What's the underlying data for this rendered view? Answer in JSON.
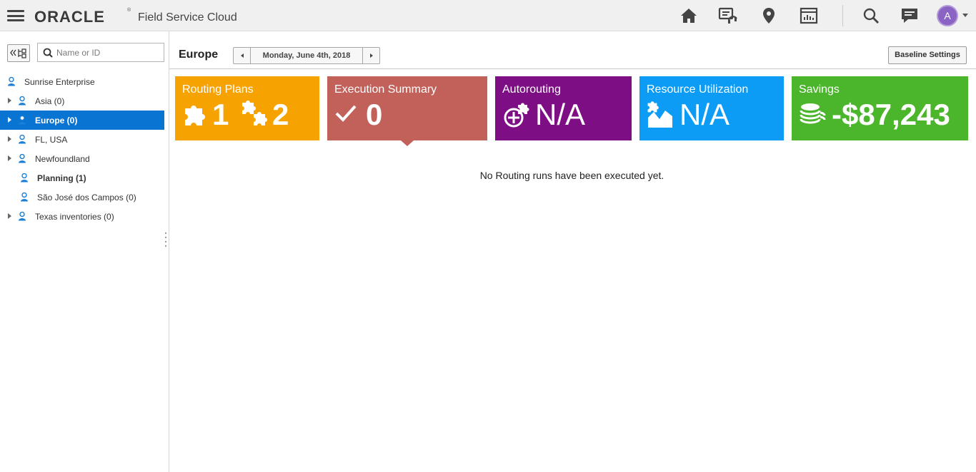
{
  "header": {
    "brand": "ORACLE",
    "brand_mark": "®",
    "product": "Field Service Cloud",
    "icons": [
      "home-icon",
      "dispatch-console-icon",
      "map-pin-icon",
      "reports-icon",
      "search-icon",
      "messages-icon"
    ],
    "avatar_initial": "A"
  },
  "sidebar": {
    "collapse_label": "«",
    "search_placeholder": "Name or ID",
    "search_value": "",
    "tree": [
      {
        "label": "Sunrise Enterprise",
        "expandable": false
      },
      {
        "label": "Asia (0)",
        "expandable": true
      },
      {
        "label": "Europe (0)",
        "expandable": true,
        "selected": true
      },
      {
        "label": "FL, USA",
        "expandable": true
      },
      {
        "label": "Newfoundland",
        "expandable": true
      },
      {
        "label": "Planning (1)",
        "expandable": false
      },
      {
        "label": "São José dos Campos (0)",
        "expandable": false
      },
      {
        "label": "Texas inventories (0)",
        "expandable": true
      }
    ]
  },
  "main": {
    "title": "Europe",
    "date": "Monday, June 4th, 2018",
    "baseline_button": "Baseline Settings",
    "tiles": [
      {
        "title": "Routing Plans",
        "value_a": "1",
        "value_b": "2",
        "color": "#f6a200"
      },
      {
        "title": "Execution Summary",
        "value": "0",
        "color": "#c2605a"
      },
      {
        "title": "Autorouting",
        "value": "N/A",
        "color": "#7d0e83"
      },
      {
        "title": "Resource Utilization",
        "value": "N/A",
        "color": "#0c9bf5"
      },
      {
        "title": "Savings",
        "value": "-$87,243",
        "color": "#4bb52b"
      }
    ],
    "message": "No Routing runs have been executed yet."
  },
  "colors": {
    "selected_row": "#0a74d2",
    "user_icon": "#1a7fd6",
    "avatar": "#8b63c4"
  }
}
